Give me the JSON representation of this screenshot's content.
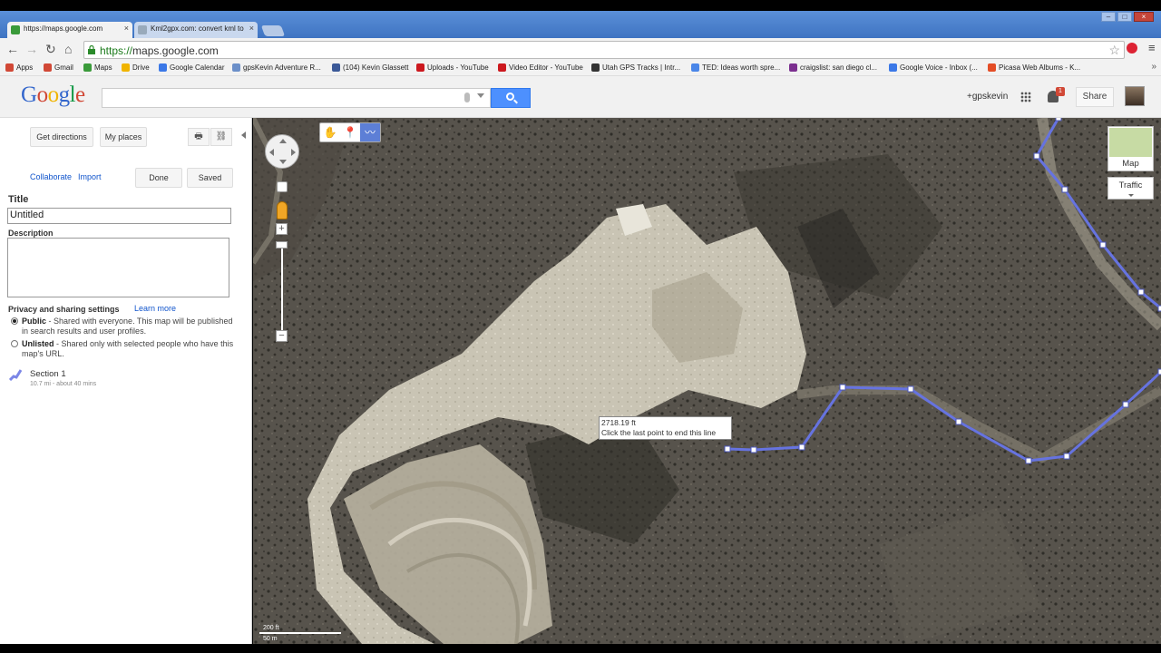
{
  "browser": {
    "tabs": [
      {
        "label": "https://maps.google.com",
        "close": "×"
      },
      {
        "label": "Kml2gpx.com: convert kml to",
        "close": "×"
      }
    ],
    "url_scheme": "https://",
    "url_host": "maps.google.com",
    "nav": {
      "back": "←",
      "forward": "→",
      "reload": "↻",
      "home": "⌂"
    },
    "star": "☆",
    "menu": "≡",
    "window": {
      "minimize": "–",
      "maximize": "□",
      "close": "×"
    },
    "bookmarks": [
      {
        "label": "Apps",
        "color": "#d14836"
      },
      {
        "label": "Gmail",
        "color": "#d14836"
      },
      {
        "label": "Maps",
        "color": "#3a9a3a"
      },
      {
        "label": "Drive",
        "color": "#f0b400"
      },
      {
        "label": "Google Calendar",
        "color": "#3b78e7"
      },
      {
        "label": "gpsKevin Adventure R...",
        "color": "#6b8fc9"
      },
      {
        "label": "(104) Kevin Glassett",
        "color": "#3b5998"
      },
      {
        "label": "Uploads - YouTube",
        "color": "#cc181e"
      },
      {
        "label": "Video Editor - YouTube",
        "color": "#cc181e"
      },
      {
        "label": "Utah GPS Tracks | Intr...",
        "color": "#333333"
      },
      {
        "label": "TED: Ideas worth spre...",
        "color": "#4a86e8"
      },
      {
        "label": "craigslist: san diego cl...",
        "color": "#7b2f8f"
      },
      {
        "label": "Google Voice - Inbox (...",
        "color": "#3b78e7"
      },
      {
        "label": "Picasa Web Albums - K...",
        "color": "#e44d26"
      }
    ],
    "bookmarks_more": "»"
  },
  "google_header": {
    "logo": [
      "G",
      "o",
      "o",
      "g",
      "l",
      "e"
    ],
    "search_value": "",
    "user": "+gpskevin",
    "notifications": "1",
    "share": "Share"
  },
  "panel": {
    "get_directions": "Get directions",
    "my_places": "My places",
    "print_icon": "🖶",
    "link_icon": "⛓",
    "collaborate": "Collaborate",
    "import": "Import",
    "done": "Done",
    "saved": "Saved",
    "title_label": "Title",
    "title_value": "Untitled",
    "description_label": "Description",
    "privacy_label": "Privacy and sharing settings",
    "learn_more": "Learn more",
    "public_label": "Public",
    "public_text": " - Shared with everyone. This map will be published in search results and user profiles.",
    "unlisted_label": "Unlisted",
    "unlisted_text": " - Shared only with selected people who have this map's URL.",
    "section_name": "Section 1",
    "section_sub": "10.7 mi - about 40 mins"
  },
  "map": {
    "modes": [
      "✋",
      "📍",
      "〰"
    ],
    "map_type": "Map",
    "traffic": "Traffic",
    "tooltip_distance": "2718.19 ft",
    "tooltip_hint": "Click the last point to end this line",
    "scale_ft": "200 ft",
    "scale_m": "50 m",
    "line_color": "#6673e0",
    "zoom_in": "+",
    "zoom_out": "−"
  }
}
